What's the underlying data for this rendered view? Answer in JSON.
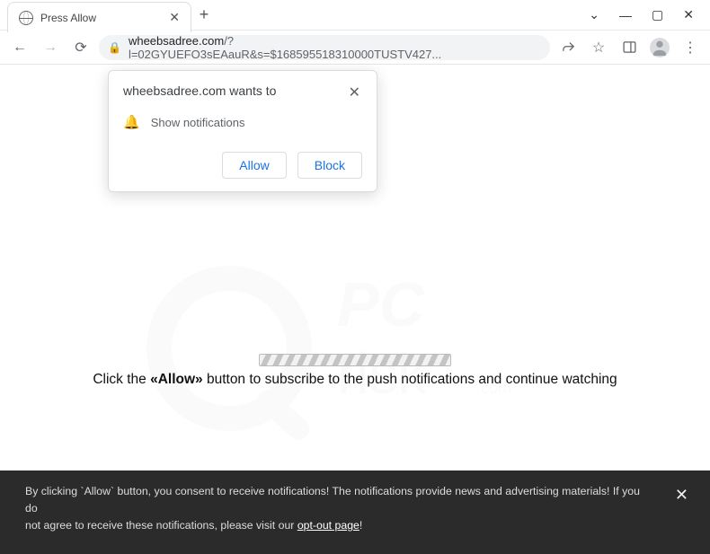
{
  "window": {
    "tab_title": "Press Allow"
  },
  "omnibox": {
    "host": "wheebsadree.com",
    "path": "/?l=02GYUEFO3sEAauR&s=$168595518310000TUSTV427..."
  },
  "permission": {
    "origin_wants": "wheebsadree.com wants to",
    "permission_label": "Show notifications",
    "allow": "Allow",
    "block": "Block"
  },
  "page": {
    "instruction_prefix": "Click the ",
    "instruction_strong": "«Allow»",
    "instruction_suffix": " button to subscribe to the push notifications and continue watching"
  },
  "banner": {
    "line1": "By clicking `Allow` button, you consent to receive notifications! The notifications provide news and advertising materials! If you do",
    "line2a": "not agree to receive these notifications, please visit our ",
    "link": "opt-out page",
    "line2b": "!"
  }
}
